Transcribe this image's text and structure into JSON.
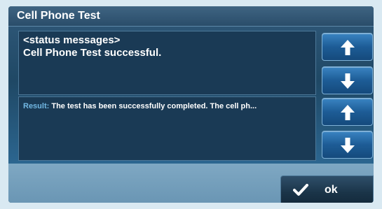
{
  "title_bar": {
    "title": "Cell Phone Test"
  },
  "status_messages": {
    "lines": [
      "<status messages>",
      "Cell Phone Test successful."
    ]
  },
  "result": {
    "label": "Result:",
    "text": "The test has been successfully completed. The cell ph..."
  },
  "scroll_buttons": {
    "status_up_icon": "arrow-up-icon",
    "status_down_icon": "arrow-down-icon",
    "result_up_icon": "arrow-up-icon",
    "result_down_icon": "arrow-down-icon"
  },
  "footer": {
    "ok_label": "ok",
    "ok_icon": "checkmark-icon"
  },
  "colors": {
    "title_bar": "#2f5574",
    "pane_background": "#1a3a55",
    "result_label": "#72b8e4",
    "arrow_button": "#1d5c96",
    "footer": "#7fa8c3",
    "ok_button": "#1a3448"
  }
}
